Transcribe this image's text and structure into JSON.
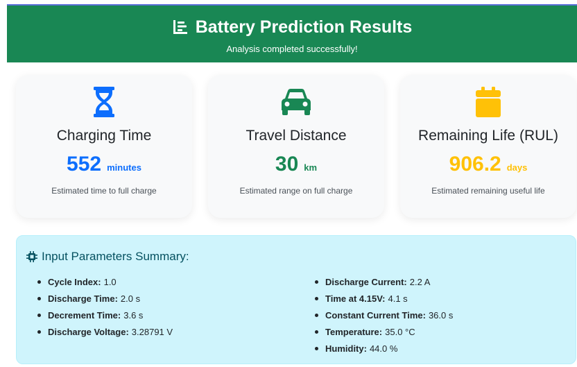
{
  "header": {
    "title": "Battery Prediction Results",
    "subtitle": "Analysis completed successfully!",
    "icon": "chart-bar-icon",
    "bg_color": "#198754"
  },
  "cards": [
    {
      "icon": "hourglass-icon",
      "title": "Charging Time",
      "value": "552",
      "unit": "minutes",
      "desc": "Estimated time to full charge",
      "color": "#0d6efd"
    },
    {
      "icon": "car-icon",
      "title": "Travel Distance",
      "value": "30",
      "unit": "km",
      "desc": "Estimated range on full charge",
      "color": "#198754"
    },
    {
      "icon": "calendar-icon",
      "title": "Remaining Life (RUL)",
      "value": "906.2",
      "unit": "days",
      "desc": "Estimated remaining useful life",
      "color": "#ffc107"
    }
  ],
  "summary": {
    "title": "Input Parameters Summary:",
    "icon": "microchip-icon",
    "left": [
      {
        "k": "Cycle Index:",
        "v": "1.0"
      },
      {
        "k": "Discharge Time:",
        "v": "2.0 s"
      },
      {
        "k": "Decrement Time:",
        "v": "3.6 s"
      },
      {
        "k": "Discharge Voltage:",
        "v": "3.28791 V"
      }
    ],
    "right": [
      {
        "k": "Discharge Current:",
        "v": "2.2 A"
      },
      {
        "k": "Time at 4.15V:",
        "v": "4.1 s"
      },
      {
        "k": "Constant Current Time:",
        "v": "36.0 s"
      },
      {
        "k": "Temperature:",
        "v": "35.0 °C"
      },
      {
        "k": "Humidity:",
        "v": "44.0 %"
      }
    ]
  }
}
